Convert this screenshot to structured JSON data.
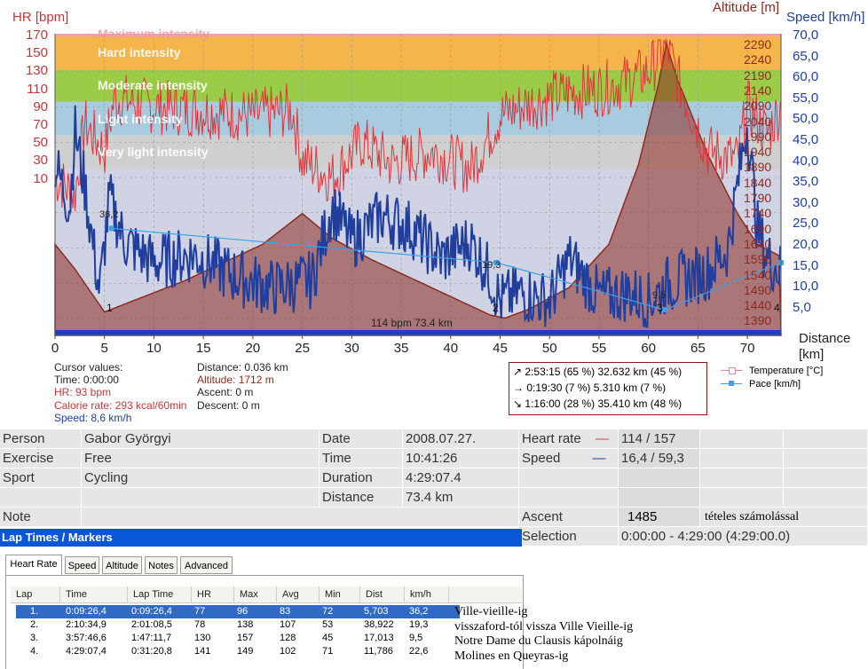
{
  "chart": {
    "left_axis_title": "HR [bpm]",
    "right_axis_title_alt": "Altitude [m]",
    "right_axis_title_speed": "Speed [km/h]",
    "x_axis_title_1": "Distance",
    "x_axis_title_2": "[km]",
    "hr_ticks": [
      "170",
      "150",
      "130",
      "110",
      "90",
      "70",
      "50",
      "30",
      "10"
    ],
    "alt_ticks": [
      "2290",
      "2240",
      "2190",
      "2140",
      "2090",
      "2040",
      "1990",
      "1940",
      "1890",
      "1840",
      "1790",
      "1740",
      "1690",
      "1640",
      "1590",
      "1540",
      "1490",
      "1440",
      "1390"
    ],
    "speed_ticks": [
      "70,0",
      "65,0",
      "60,0",
      "55,0",
      "50,0",
      "45,0",
      "40,0",
      "35,0",
      "30,0",
      "25,0",
      "20,0",
      "15,0",
      "10,0",
      "5,0"
    ],
    "x_ticks": [
      "0",
      "5",
      "10",
      "15",
      "20",
      "25",
      "30",
      "35",
      "40",
      "45",
      "50",
      "55",
      "60",
      "65",
      "70"
    ],
    "zones": [
      {
        "label": "Maximum intensity",
        "color": "#f4a0a8"
      },
      {
        "label": "Hard intensity",
        "color": "#f5b54a"
      },
      {
        "label": "Moderate intensity",
        "color": "#9bcc48"
      },
      {
        "label": "Light intensity",
        "color": "#a9cbe0"
      },
      {
        "label": "Very light intensity",
        "color": "#cfcfcf"
      }
    ],
    "bottom_label": "114 bpm 73.4 km",
    "pace_markers": [
      "36,2",
      "19,3",
      "9,5"
    ],
    "lap_markers": [
      "1",
      "2",
      "3",
      "4"
    ],
    "colors": {
      "hr": "#e0343a",
      "speed": "#1f3e9e",
      "altitude": "#8e2a20",
      "pace": "#3ea0e8",
      "axis_hr": "#b03030",
      "axis_speed": "#1f3e9e"
    }
  },
  "cursor": {
    "title": "Cursor values:",
    "time": "Time: 0:00:00",
    "hr": "HR: 93 bpm",
    "calorie": "Calorie rate: 293 kcal/60min",
    "speed": "Speed: 8,6 km/h",
    "distance": "Distance: 0.036 km",
    "altitude": "Altitude: 1712 m",
    "ascent": "Ascent: 0 m",
    "descent": "Descent: 0 m"
  },
  "stats_box": {
    "up": "↗ 2:53:15  (65 %) 32.632 km  (45 %)",
    "flat": "→ 0:19:30    (7 %)   5.310 km    (7 %)",
    "down": "↘ 1:16:00  (28 %) 35.410 km  (48 %)"
  },
  "legend": [
    {
      "label": "Temperature [°C]",
      "color": "#e88a90"
    },
    {
      "label": "Pace [km/h]",
      "color": "#3ea0e8"
    }
  ],
  "info": {
    "person_label": "Person",
    "person": "Gabor Györgyi",
    "exercise_label": "Exercise",
    "exercise": "Free",
    "sport_label": "Sport",
    "sport": "Cycling",
    "note_label": "Note",
    "date_label": "Date",
    "date": "2008.07.27.",
    "time_label": "Time",
    "time": "10:41:26",
    "duration_label": "Duration",
    "duration": "4:29:07.4",
    "distance_label": "Distance",
    "distance": "73.4 km",
    "hr_label": "Heart rate",
    "hr_line": "—",
    "hr_value": "114 / 157",
    "speed_label": "Speed",
    "speed_line": "—",
    "speed_value": "16,4 / 59,3",
    "ascent_label": "Ascent",
    "ascent_value": "1485",
    "ascent_note": "tételes számolással",
    "selection_label": "Selection",
    "selection_value": "0:00:00 - 4:29:00 (4:29:00.0)"
  },
  "laps_panel": {
    "title": "Lap Times / Markers",
    "tabs": [
      "Heart Rate",
      "Speed",
      "Altitude",
      "Notes",
      "Advanced"
    ],
    "columns": [
      "Lap",
      "Time",
      "Lap Time",
      "HR",
      "Max",
      "Avg",
      "Min",
      "Dist",
      "km/h"
    ],
    "rows": [
      {
        "lap": "1.",
        "time": "0:09:26,4",
        "laptime": "0:09:26,4",
        "hr": "77",
        "max": "96",
        "avg": "83",
        "min": "72",
        "dist": "5,703",
        "kmh": "36,2",
        "note": "Ville-vieille-ig"
      },
      {
        "lap": "2.",
        "time": "2:10:34,9",
        "laptime": "2:01:08,5",
        "hr": "78",
        "max": "138",
        "avg": "107",
        "min": "53",
        "dist": "38,922",
        "kmh": "19,3",
        "note": "visszaford-tól vissza Ville Vieille-ig"
      },
      {
        "lap": "3.",
        "time": "3:57:46,6",
        "laptime": "1:47:11,7",
        "hr": "130",
        "max": "157",
        "avg": "128",
        "min": "45",
        "dist": "17,013",
        "kmh": "9,5",
        "note": "Notre Dame du Clausis kápolnáig"
      },
      {
        "lap": "4.",
        "time": "4:29:07,4",
        "laptime": "0:31:20,8",
        "hr": "141",
        "max": "149",
        "avg": "102",
        "min": "71",
        "dist": "11,786",
        "kmh": "22,6",
        "note": "Molines en Queyras-ig"
      }
    ]
  }
}
